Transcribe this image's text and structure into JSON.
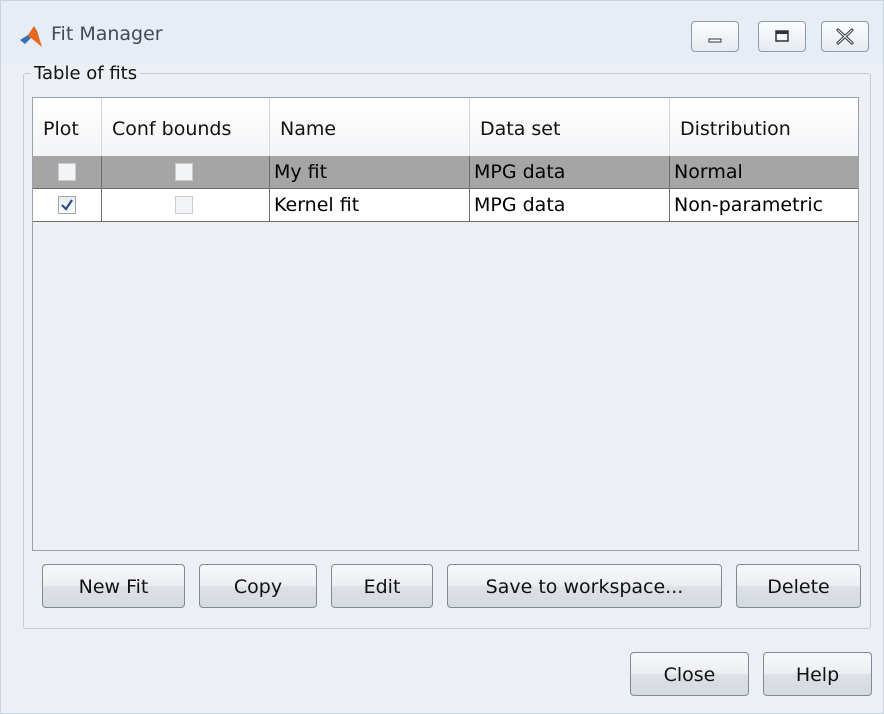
{
  "window": {
    "title": "Fit Manager"
  },
  "group": {
    "label": "Table of fits"
  },
  "table": {
    "columns": [
      "Plot",
      "Conf bounds",
      "Name",
      "Data set",
      "Distribution"
    ],
    "rows": [
      {
        "plot": false,
        "conf_bounds": false,
        "name": "My fit",
        "data_set": "MPG data",
        "distribution": "Normal",
        "selected": true
      },
      {
        "plot": true,
        "conf_bounds": false,
        "name": "Kernel fit",
        "data_set": "MPG data",
        "distribution": "Non-parametric",
        "selected": false
      }
    ]
  },
  "buttons": {
    "new_fit": "New Fit",
    "copy": "Copy",
    "edit": "Edit",
    "save": "Save to workspace...",
    "delete": "Delete",
    "close": "Close",
    "help": "Help"
  },
  "icons": {
    "app": "matlab-logo-icon",
    "minimize": "minimize-icon",
    "maximize": "maximize-icon",
    "close": "close-icon"
  },
  "colors": {
    "selected_row": "#a5a5a5",
    "titlebar": "#e7edf4",
    "background": "#eceff3"
  }
}
